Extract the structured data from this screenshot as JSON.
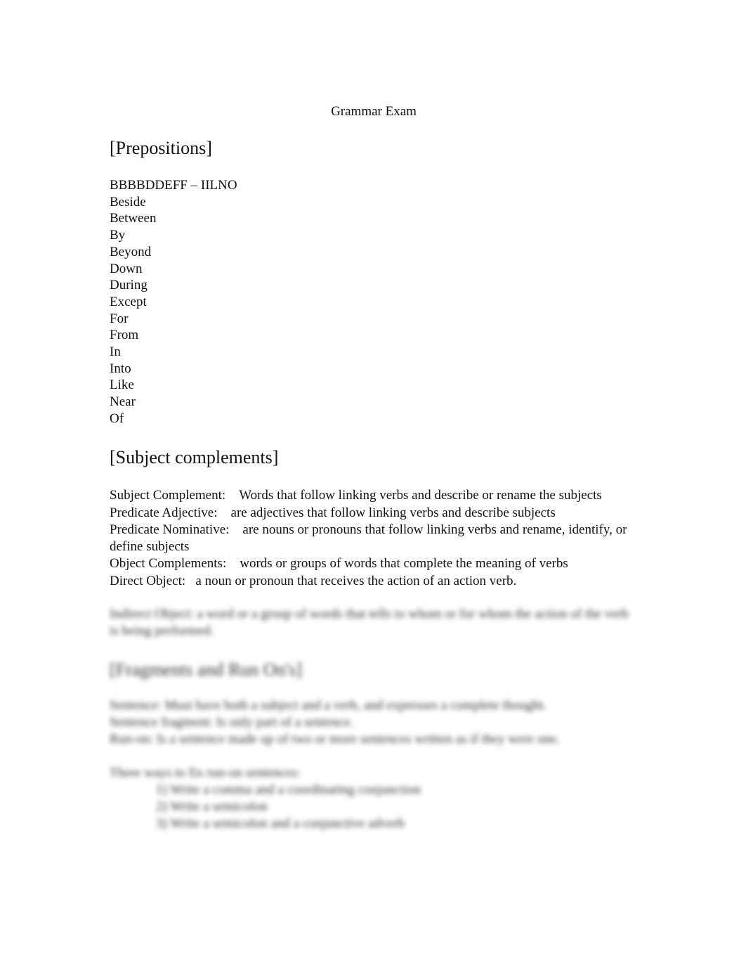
{
  "document": {
    "title": "Grammar Exam",
    "sections": {
      "prepositions": {
        "heading": "[Prepositions]",
        "mnemonic": "BBBBDDEFF – IILNO",
        "items": [
          "Beside",
          "Between",
          "By",
          "Beyond",
          "Down",
          "During",
          "Except",
          "For",
          "From",
          "In",
          "Into",
          "Like",
          "Near",
          "Of"
        ]
      },
      "subject_complements": {
        "heading": "[Subject complements]",
        "entries": [
          {
            "term": "Subject Complement:",
            "definition": "Words that follow linking verbs and describe or rename the subjects"
          },
          {
            "term": "Predicate Adjective:",
            "definition": "are adjectives that follow linking verbs and describe subjects"
          },
          {
            "term": "Predicate Nominative:",
            "definition": "are nouns or pronouns that follow linking verbs and rename, identify, or define subjects"
          },
          {
            "term": "Object Complements:",
            "definition": "words or groups of words that complete the meaning of verbs"
          },
          {
            "term": "Direct Object:",
            "definition": "a noun or pronoun that receives the action of an action verb."
          }
        ],
        "blurred_entry": "Indirect Object: a word or a group of words that tells to whom or for whom the action of the verb is being performed."
      },
      "fragments": {
        "heading": "[Fragments and Run On's]",
        "lines": [
          "Sentence: Must have both a subject and a verb, and expresses a complete thought.",
          "Sentence fragment: Is only part of a sentence.",
          "Run-on: Is a sentence made up of two or more sentences written as if they were one."
        ],
        "fix_intro": "Three ways to fix run-on sentences:",
        "fixes": [
          "1) Write a comma and a coordinating conjunction",
          "2) Write a semicolon",
          "3) Write a semicolon and a conjunctive adverb"
        ]
      }
    }
  }
}
